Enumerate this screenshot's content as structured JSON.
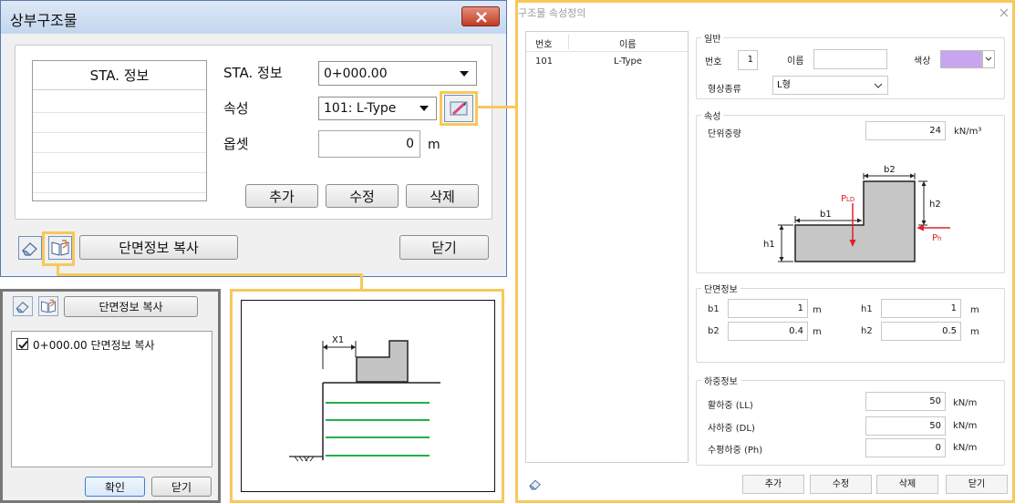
{
  "main_dialog": {
    "title": "상부구조물",
    "table_header": "STA. 정보",
    "sta_label": "STA. 정보",
    "sta_value": "0+000.00",
    "attr_label": "속성",
    "attr_value": "101: L-Type",
    "offset_label": "옵셋",
    "offset_value": "0",
    "offset_unit": "m",
    "add_btn": "추가",
    "edit_btn": "수정",
    "delete_btn": "삭제",
    "copy_btn": "단면정보 복사",
    "close_btn": "닫기"
  },
  "copy_dialog": {
    "copy_btn": "단면정보 복사",
    "item_label": "0+000.00 단면정보 복사",
    "item_checked": true,
    "ok_btn": "확인",
    "close_btn": "닫기"
  },
  "preview": {
    "dim_label": "X1"
  },
  "property_dialog": {
    "title": "구조물 속성정의",
    "list_headers": [
      "번호",
      "이름"
    ],
    "list_rows": [
      {
        "no": "101",
        "name": "L-Type"
      }
    ],
    "general": {
      "group": "일반",
      "no_label": "번호",
      "no_value": "1",
      "name_label": "이름",
      "name_value": "",
      "color_label": "색상",
      "color_value": "#c8a6ef",
      "shape_label": "형상종류",
      "shape_value": "L형"
    },
    "attribute": {
      "group": "속성",
      "unit_weight_label": "단위중량",
      "unit_weight_value": "24",
      "unit_weight_unit": "kN/m³"
    },
    "diagram": {
      "b1": "b1",
      "b2": "b2",
      "h1": "h1",
      "h2": "h2",
      "pld_main": "P",
      "pld_sub": "LD",
      "ph_main": "P",
      "ph_sub": "h"
    },
    "section": {
      "group": "단면정보",
      "b1_label": "b1",
      "b1_value": "1",
      "h1_label": "h1",
      "h1_value": "1",
      "b2_label": "b2",
      "b2_value": "0.4",
      "h2_label": "h2",
      "h2_value": "0.5",
      "unit": "m"
    },
    "load": {
      "group": "하중정보",
      "live_label": "활하중 (LL)",
      "live_value": "50",
      "dead_label": "사하중 (DL)",
      "dead_value": "50",
      "horiz_label": "수평하중 (Ph)",
      "horiz_value": "0",
      "unit": "kN/m"
    },
    "buttons": {
      "add": "추가",
      "edit": "수정",
      "delete": "삭제",
      "close": "닫기"
    }
  },
  "colors": {
    "highlight": "#f7c85a",
    "title_bar": "#c9daf0",
    "load_arrow": "#e0202a",
    "soil_line": "#22b04a"
  }
}
